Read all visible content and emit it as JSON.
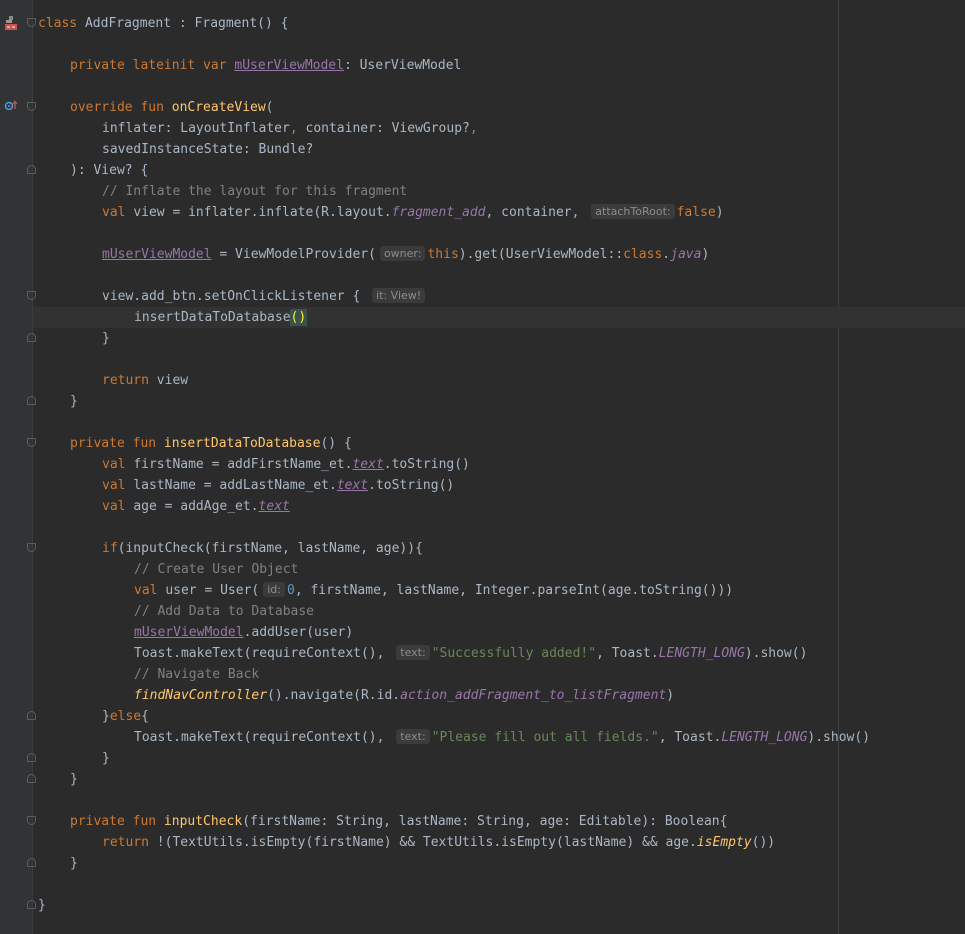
{
  "editor": {
    "lines": {
      "l1": {
        "kw_class": "class",
        "name": "AddFragment",
        "colon": " : ",
        "parent": "Fragment() {"
      },
      "l3": {
        "kw": "private lateinit var ",
        "prop": "mUserViewModel",
        "rest": ": UserViewModel"
      },
      "l5": {
        "kw": "override fun ",
        "fn": "onCreateView",
        "rest": "("
      },
      "l6": {
        "a": "inflater: LayoutInflater",
        "comma": ", ",
        "b": "container: ViewGroup?",
        "comma2": ","
      },
      "l7": {
        "a": "savedInstanceState: Bundle?"
      },
      "l8": {
        "a": "): View? {"
      },
      "l9": {
        "comment": "// Inflate the layout for this fragment"
      },
      "l10": {
        "kw": "val ",
        "a": "view = inflater.inflate(R.layout.",
        "it": "fragment_add",
        "b": ", container, ",
        "hint": "attachToRoot:",
        "kw2": "false",
        "c": ")"
      },
      "l12": {
        "prop": "mUserViewModel",
        "a": " = ViewModelProvider(",
        "hint": "owner:",
        "kw": "this",
        "b": ").get(UserViewModel::",
        "kw2": "class",
        "dot": ".",
        "it": "java",
        "c": ")"
      },
      "l14": {
        "a": "view.add_btn.setOnClickListener { ",
        "hint": "it: View!"
      },
      "l15": {
        "fn": "insertDataToDatabase",
        "paren": "()"
      },
      "l16": {
        "a": "}"
      },
      "l18": {
        "kw": "return ",
        "a": "view"
      },
      "l19": {
        "a": "}"
      },
      "l21": {
        "kw": "private fun ",
        "fn": "insertDataToDatabase",
        "a": "() {"
      },
      "l22": {
        "kw": "val ",
        "a": "firstName = addFirstName_et.",
        "prop": "text",
        "b": ".toString()"
      },
      "l23": {
        "kw": "val ",
        "a": "lastName = addLastName_et.",
        "prop": "text",
        "b": ".toString()"
      },
      "l24": {
        "kw": "val ",
        "a": "age = addAge_et.",
        "prop": "text"
      },
      "l26": {
        "kw": "if",
        "a": "(inputCheck(firstName, lastName, age)){"
      },
      "l27": {
        "comment": "// Create User Object"
      },
      "l28": {
        "kw": "val ",
        "a": "user = User(",
        "hint": "id:",
        "num": "0",
        "b": ", firstName, lastName, Integer.parseInt(age.toString()))"
      },
      "l29": {
        "comment": "// Add Data to Database"
      },
      "l30": {
        "prop": "mUserViewModel",
        "a": ".addUser(user)"
      },
      "l31": {
        "a": "Toast.makeText(requireContext(), ",
        "hint": "text:",
        "str": "\"Successfully added!\"",
        "b": ", Toast.",
        "it": "LENGTH_LONG",
        "c": ").show()"
      },
      "l32": {
        "comment": "// Navigate Back"
      },
      "l33": {
        "ext": "findNavController",
        "a": "().navigate(R.id.",
        "it": "action_addFragment_to_listFragment",
        "b": ")"
      },
      "l34": {
        "a": "}",
        "kw": "else",
        "b": "{"
      },
      "l35": {
        "a": "Toast.makeText(requireContext(), ",
        "hint": "text:",
        "str": "\"Please fill out all fields.\"",
        "b": ", Toast.",
        "it": "LENGTH_LONG",
        "c": ").show()"
      },
      "l36": {
        "a": "}"
      },
      "l37": {
        "a": "}"
      },
      "l39": {
        "kw": "private fun ",
        "fn": "inputCheck",
        "a": "(firstName: String, lastName: String, age: Editable): Boolean{"
      },
      "l40": {
        "kw": "return ",
        "a": "!(TextUtils.isEmpty(firstName) && TextUtils.isEmpty(lastName) && age.",
        "it": "isEmpty",
        "b": "())"
      },
      "l41": {
        "a": "}"
      },
      "l43": {
        "a": "}"
      }
    },
    "gutter_icons": [
      "class-structure-icon",
      "override-method-icon"
    ]
  },
  "colors": {
    "background": "#2b2b2b",
    "keyword": "#cc7832",
    "function": "#ffc66d",
    "property": "#9876aa",
    "comment": "#808080",
    "string": "#6a8759",
    "number": "#6897bb",
    "text": "#a9b7c6"
  }
}
